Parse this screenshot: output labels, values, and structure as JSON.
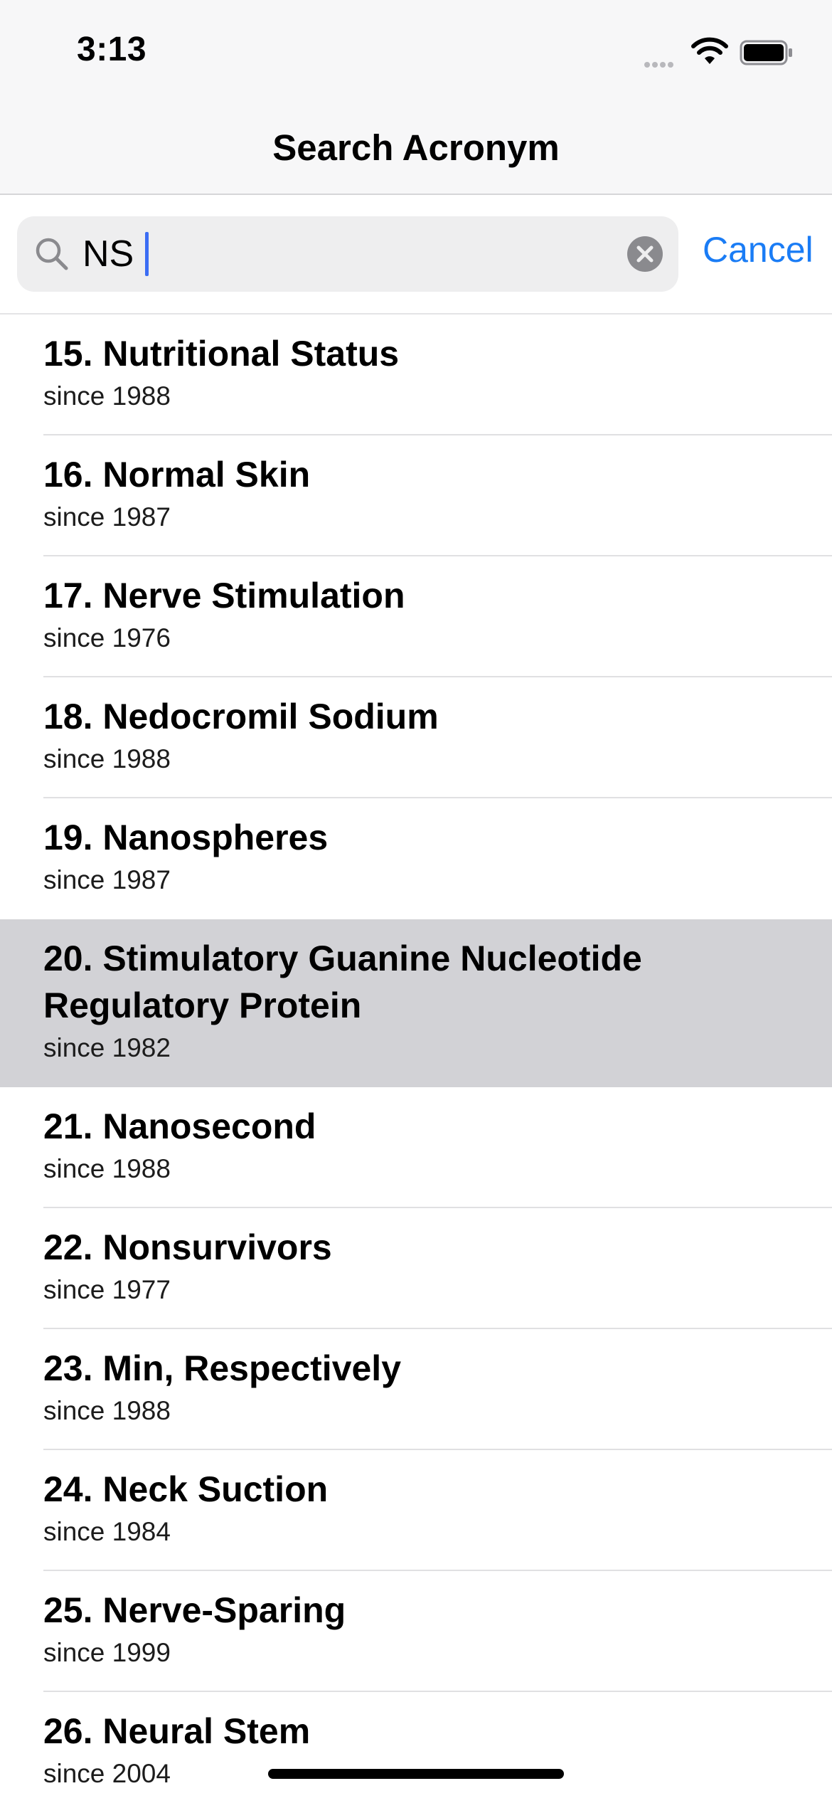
{
  "status_bar": {
    "time": "3:13"
  },
  "nav": {
    "title": "Search Acronym"
  },
  "search": {
    "value": "NS",
    "cancel_label": "Cancel"
  },
  "results": [
    {
      "title": "15. Nutritional Status",
      "since": "since 1988"
    },
    {
      "title": "16. Normal Skin",
      "since": "since 1987"
    },
    {
      "title": "17. Nerve Stimulation",
      "since": "since 1976"
    },
    {
      "title": "18. Nedocromil Sodium",
      "since": "since 1988"
    },
    {
      "title": "19. Nanospheres",
      "since": "since 1987"
    },
    {
      "title": "20. Stimulatory Guanine Nucleotide Regulatory Protein",
      "since": "since 1982",
      "selected": true
    },
    {
      "title": "21. Nanosecond",
      "since": "since 1988"
    },
    {
      "title": "22. Nonsurvivors",
      "since": "since 1977"
    },
    {
      "title": "23. Min, Respectively",
      "since": "since 1988"
    },
    {
      "title": "24. Neck Suction",
      "since": "since 1984"
    },
    {
      "title": "25. Nerve-Sparing",
      "since": "since 1999"
    },
    {
      "title": "26. Neural Stem",
      "since": "since 2004"
    }
  ],
  "colors": {
    "accent": "#1a7cf5",
    "selected_row": "#d2d2d6",
    "bar_background": "#f7f7f8",
    "caret": "#3b6df4"
  }
}
